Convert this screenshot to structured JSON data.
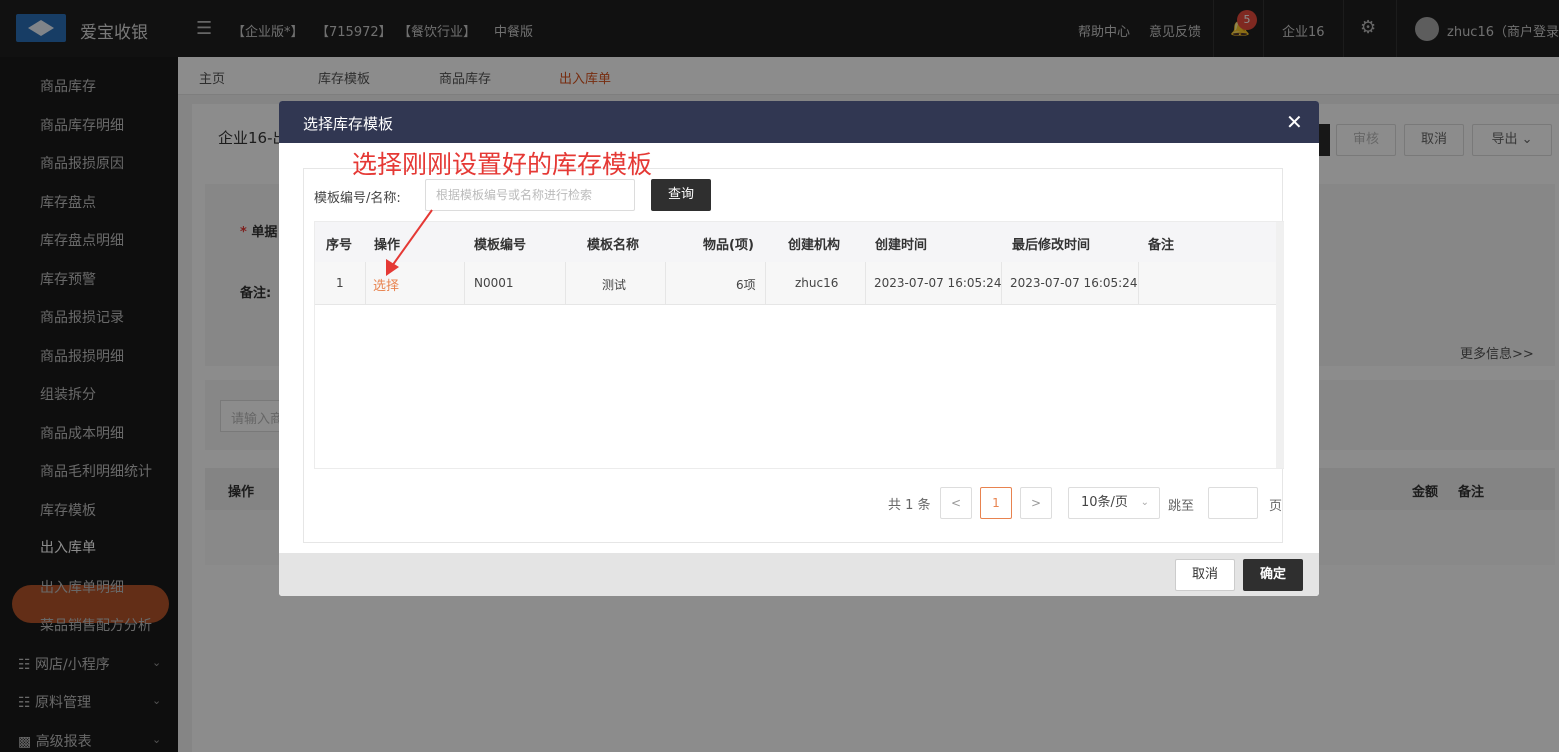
{
  "header": {
    "brand": "爱宝收银",
    "tags": [
      "【企业版*】",
      "【715972】",
      "【餐饮行业】",
      "中餐版"
    ],
    "help": "帮助中心",
    "feedback": "意见反馈",
    "notifications": "5",
    "company": "企业16",
    "user": "zhuc16（商户登录"
  },
  "sidebar": {
    "items": [
      "商品库存",
      "商品库存明细",
      "商品报损原因",
      "库存盘点",
      "库存盘点明细",
      "库存预警",
      "商品报损记录",
      "商品报损明细",
      "组装拆分",
      "商品成本明细",
      "商品毛利明细统计",
      "库存模板",
      "出入库单",
      "出入库单明细",
      "菜品销售配方分析"
    ],
    "active": "出入库单",
    "groups": [
      "网店/小程序",
      "原料管理",
      "高级报表"
    ]
  },
  "tabs": [
    "主页",
    "库存模板",
    "商品库存",
    "出入库单"
  ],
  "background": {
    "title": "企业16-出",
    "buttons": [
      "审核",
      "取消",
      "导出"
    ],
    "doc_label": "单据",
    "remark_label": "备注:",
    "more": "更多信息>>",
    "search_placeholder": "请输入商",
    "table_headers": [
      "操作",
      "金额",
      "备注"
    ]
  },
  "modal": {
    "title": "选择库存模板",
    "search_label": "模板编号/名称:",
    "search_placeholder": "根据模板编号或名称进行检索",
    "query_button": "查询",
    "columns": [
      "序号",
      "操作",
      "模板编号",
      "模板名称",
      "物品(项)",
      "创建机构",
      "创建时间",
      "最后修改时间",
      "备注"
    ],
    "rows": [
      {
        "index": "1",
        "action": "选择",
        "code": "N0001",
        "name": "测试",
        "items": "6项",
        "org": "zhuc16",
        "created": "2023-07-07 16:05:24",
        "modified": "2023-07-07 16:05:24",
        "remark": ""
      }
    ],
    "pager": {
      "total": "共 1 条",
      "prev": "<",
      "current": "1",
      "next": ">",
      "page_size": "10条/页",
      "jump_label": "跳至",
      "page_unit": "页"
    },
    "cancel_button": "取消",
    "ok_button": "确定"
  },
  "annotation": "选择刚刚设置好的库存模板"
}
